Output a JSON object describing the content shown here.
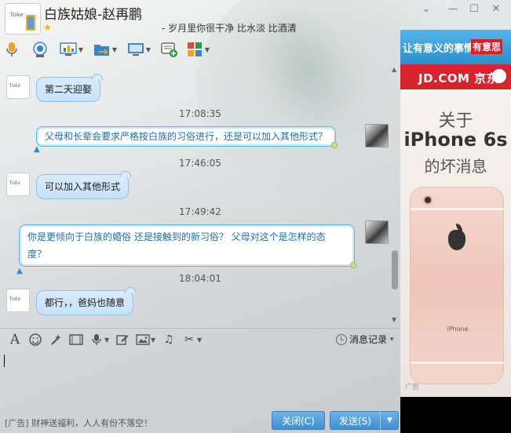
{
  "window": {
    "title": "白族姑娘-赵再鹏",
    "motto": "- 岁月里你很干净 比水淡 比酒清",
    "controls": {
      "minimize": "—",
      "maximize": "☐",
      "close": "✕",
      "skin": "⌄"
    }
  },
  "toolbar": {
    "items": [
      {
        "name": "voice-call",
        "icon": "microphone-icon"
      },
      {
        "name": "video-call",
        "icon": "webcam-icon"
      },
      {
        "name": "remote-desktop",
        "icon": "monitor-chart-icon"
      },
      {
        "name": "send-file",
        "icon": "folder-arrow-icon"
      },
      {
        "name": "screen-share",
        "icon": "screen-icon"
      },
      {
        "name": "create-group",
        "icon": "chat-plus-icon"
      },
      {
        "name": "apps",
        "icon": "apps-grid-icon"
      }
    ]
  },
  "messages": [
    {
      "side": "left",
      "text": "第二天迎娶"
    },
    {
      "timestamp": "17:08:35"
    },
    {
      "side": "right",
      "text": "父母和长辈会要求严格按白族的习俗进行，还是可以加入其他形式？"
    },
    {
      "timestamp": "17:46:05"
    },
    {
      "side": "left",
      "text": "可以加入其他形式"
    },
    {
      "timestamp": "17:49:42"
    },
    {
      "side": "right",
      "text_line1": "你是更倾向于白族的婚俗 还是接触到的新习俗？ 父母对这个是怎样的态",
      "text_line2": "度？"
    },
    {
      "timestamp": "18:04:01"
    },
    {
      "side": "left",
      "text": "都行，，爸妈也随意"
    }
  ],
  "input_toolbar": {
    "history_label": "消息记录",
    "history_arrow": "▾"
  },
  "footer": {
    "ad_text": "[广告] 财神送福利，人人有份不落空！",
    "close_button": "关闭(C)",
    "send_button": "发送(S)"
  },
  "ad": {
    "banner_text": "让有意义的事情",
    "banner_badge": "有意思",
    "brand": "JD.COM 京东",
    "line1": "关于",
    "line2": "iPhone 6s",
    "line3": "的坏消息",
    "phone_name": "iPhone",
    "ad_tag": "广告"
  },
  "avatar_signature": "Yoke"
}
